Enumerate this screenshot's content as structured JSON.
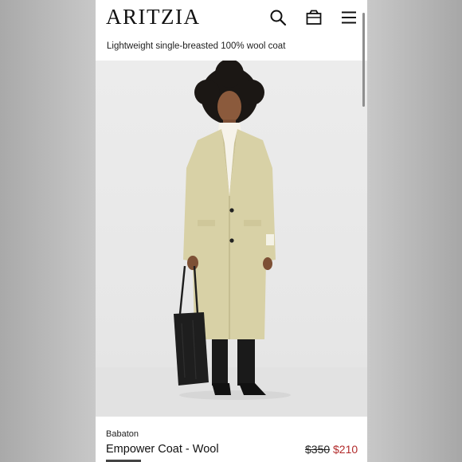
{
  "header": {
    "logo": "ARITZIA",
    "icons": [
      "search-icon",
      "bag-icon",
      "menu-icon"
    ]
  },
  "product": {
    "subtitle": "Lightweight single-breasted 100% wool coat",
    "brand": "Babaton",
    "name": "Empower Coat - Wool",
    "original_price": "$350",
    "sale_price": "$210"
  },
  "colors": {
    "sale": "#b22b2b",
    "coat": "#d8d1a6",
    "background": "#ffffff"
  }
}
